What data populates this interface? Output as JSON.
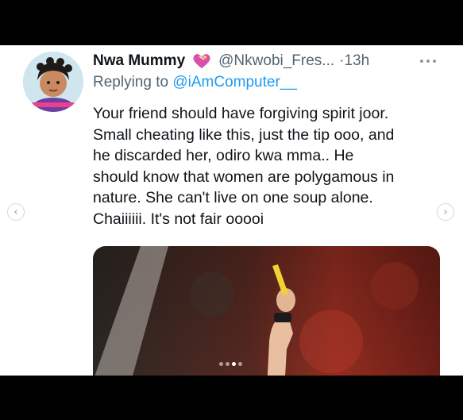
{
  "tweet": {
    "author_name": "Nwa Mummy",
    "author_handle": "@Nkwobi_Fres...",
    "time": "·13h",
    "reply_prefix": "Replying to ",
    "reply_to": "@iAmComputer__",
    "text_lines": [
      "Your friend should have forgiving spirit joor.",
      "Small cheating like this, just the tip ooo, and",
      "he discarded her, odiro kwa mma.. He",
      "should know that women are polygamous in",
      "nature. She can't live on one soup alone.",
      "Chaiiiiii. It's not fair ooooi"
    ],
    "icons": {
      "badge": "heart-emoji-icon",
      "more": "more-options-icon",
      "prev": "chevron-left-icon",
      "next": "chevron-right-icon"
    }
  },
  "carousel": {
    "slide_count": 4,
    "active_index": 2
  },
  "colors": {
    "text_primary": "#0f1419",
    "text_secondary": "#536471",
    "link": "#1d9bf0",
    "background": "#ffffff"
  }
}
